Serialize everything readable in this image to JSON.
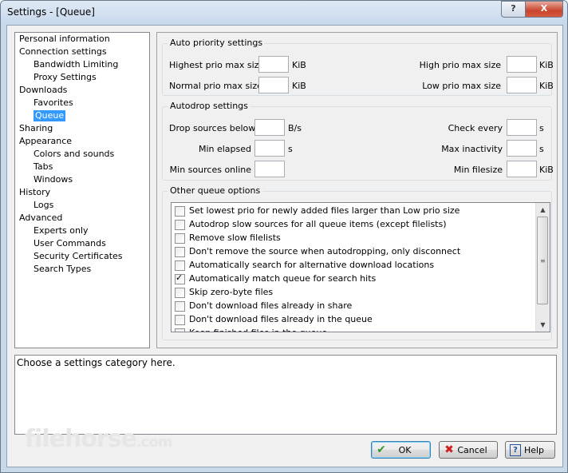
{
  "window": {
    "title": "Settings - [Queue]",
    "help_label": "?",
    "close_label": "X"
  },
  "tree": [
    "Personal information",
    "Connection settings",
    "Bandwidth Limiting",
    "Proxy Settings",
    "Downloads",
    "Favorites",
    "Queue",
    "Sharing",
    "Appearance",
    "Colors and sounds",
    "Tabs",
    "Windows",
    "History",
    "Logs",
    "Advanced",
    "Experts only",
    "User Commands",
    "Security Certificates",
    "Search Types"
  ],
  "auto_priority": {
    "title": "Auto priority settings",
    "highest_label": "Highest prio max size",
    "high_label": "High prio max size",
    "normal_label": "Normal prio max size",
    "low_label": "Low prio max size",
    "unit": "KiB"
  },
  "autodrop": {
    "title": "Autodrop settings",
    "drop_below_label": "Drop sources below",
    "drop_below_unit": "B/s",
    "check_every_label": "Check every",
    "check_every_unit": "s",
    "min_elapsed_label": "Min elapsed",
    "min_elapsed_unit": "s",
    "max_inactivity_label": "Max inactivity",
    "max_inactivity_unit": "s",
    "min_sources_label": "Min sources online",
    "min_filesize_label": "Min filesize",
    "min_filesize_unit": "KiB"
  },
  "other": {
    "title": "Other queue options",
    "items": [
      {
        "label": "Set lowest prio for newly added files larger than Low prio size",
        "checked": false
      },
      {
        "label": "Autodrop slow sources for all queue items (except filelists)",
        "checked": false
      },
      {
        "label": "Remove slow filelists",
        "checked": false
      },
      {
        "label": "Don't remove the source when autodropping, only disconnect",
        "checked": false
      },
      {
        "label": "Automatically search for alternative download locations",
        "checked": false
      },
      {
        "label": "Automatically match queue for search hits",
        "checked": true
      },
      {
        "label": "Skip zero-byte files",
        "checked": false
      },
      {
        "label": "Don't download files already in share",
        "checked": false
      },
      {
        "label": "Don't download files already in the queue",
        "checked": false
      },
      {
        "label": "Keep finished files in the queue",
        "checked": false
      }
    ],
    "check_mark": "✓"
  },
  "description": "Choose a settings category here.",
  "buttons": {
    "ok": "OK",
    "cancel": "Cancel",
    "help": "Help"
  },
  "watermark": {
    "main": "filehorse",
    "suffix": ".com"
  }
}
